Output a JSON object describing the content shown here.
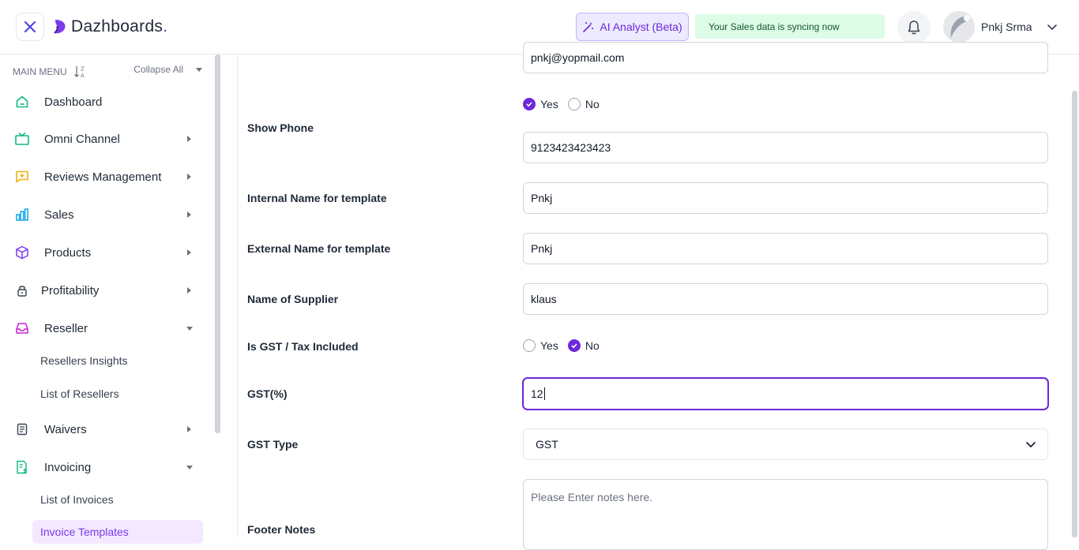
{
  "header": {
    "logo_text": "Dazhboards",
    "logo_dot": ".",
    "ai_button": "AI Analyst (Beta)",
    "sync_message": "Your Sales data is syncing now",
    "user_name": "Pnkj Srma"
  },
  "sidebar": {
    "menu_title": "MAIN MENU",
    "collapse_all": "Collapse All",
    "items": [
      {
        "label": "Dashboard",
        "icon": "home-icon",
        "color": "#10b981"
      },
      {
        "label": "Omni Channel",
        "icon": "tv-icon",
        "color": "#10b981"
      },
      {
        "label": "Reviews Management",
        "icon": "message-plus-icon",
        "color": "#eab308"
      },
      {
        "label": "Sales",
        "icon": "bar-chart-icon",
        "color": "#0ea5e9"
      },
      {
        "label": "Products",
        "icon": "box-icon",
        "color": "#7c3aed"
      },
      {
        "label": "Profitability",
        "icon": "lock-icon",
        "color": "#1f2937"
      },
      {
        "label": "Reseller",
        "icon": "inbox-icon",
        "color": "#c026d3"
      },
      {
        "label": "Waivers",
        "icon": "document-icon",
        "color": "#1f2937"
      },
      {
        "label": "Invoicing",
        "icon": "invoice-icon",
        "color": "#10b981"
      }
    ],
    "reseller_sub": [
      "Resellers Insights",
      "List of Resellers"
    ],
    "invoicing_sub": [
      "List of Invoices",
      "Invoice Templates"
    ]
  },
  "form": {
    "email_value": "pnkj@yopmail.com",
    "show_phone_label": "Show Phone",
    "yes": "Yes",
    "no": "No",
    "phone_value": "9123423423423",
    "internal_name_label": "Internal Name for template",
    "internal_name_value": "Pnkj",
    "external_name_label": "External Name for template",
    "external_name_value": "Pnkj",
    "supplier_label": "Name of Supplier",
    "supplier_value": "klaus",
    "gst_included_label": "Is GST / Tax Included",
    "gst_percent_label": "GST(%)",
    "gst_percent_value": "12",
    "gst_type_label": "GST Type",
    "gst_type_value": "GST",
    "footer_notes_label": "Footer Notes",
    "footer_notes_placeholder": "Please Enter notes here."
  }
}
